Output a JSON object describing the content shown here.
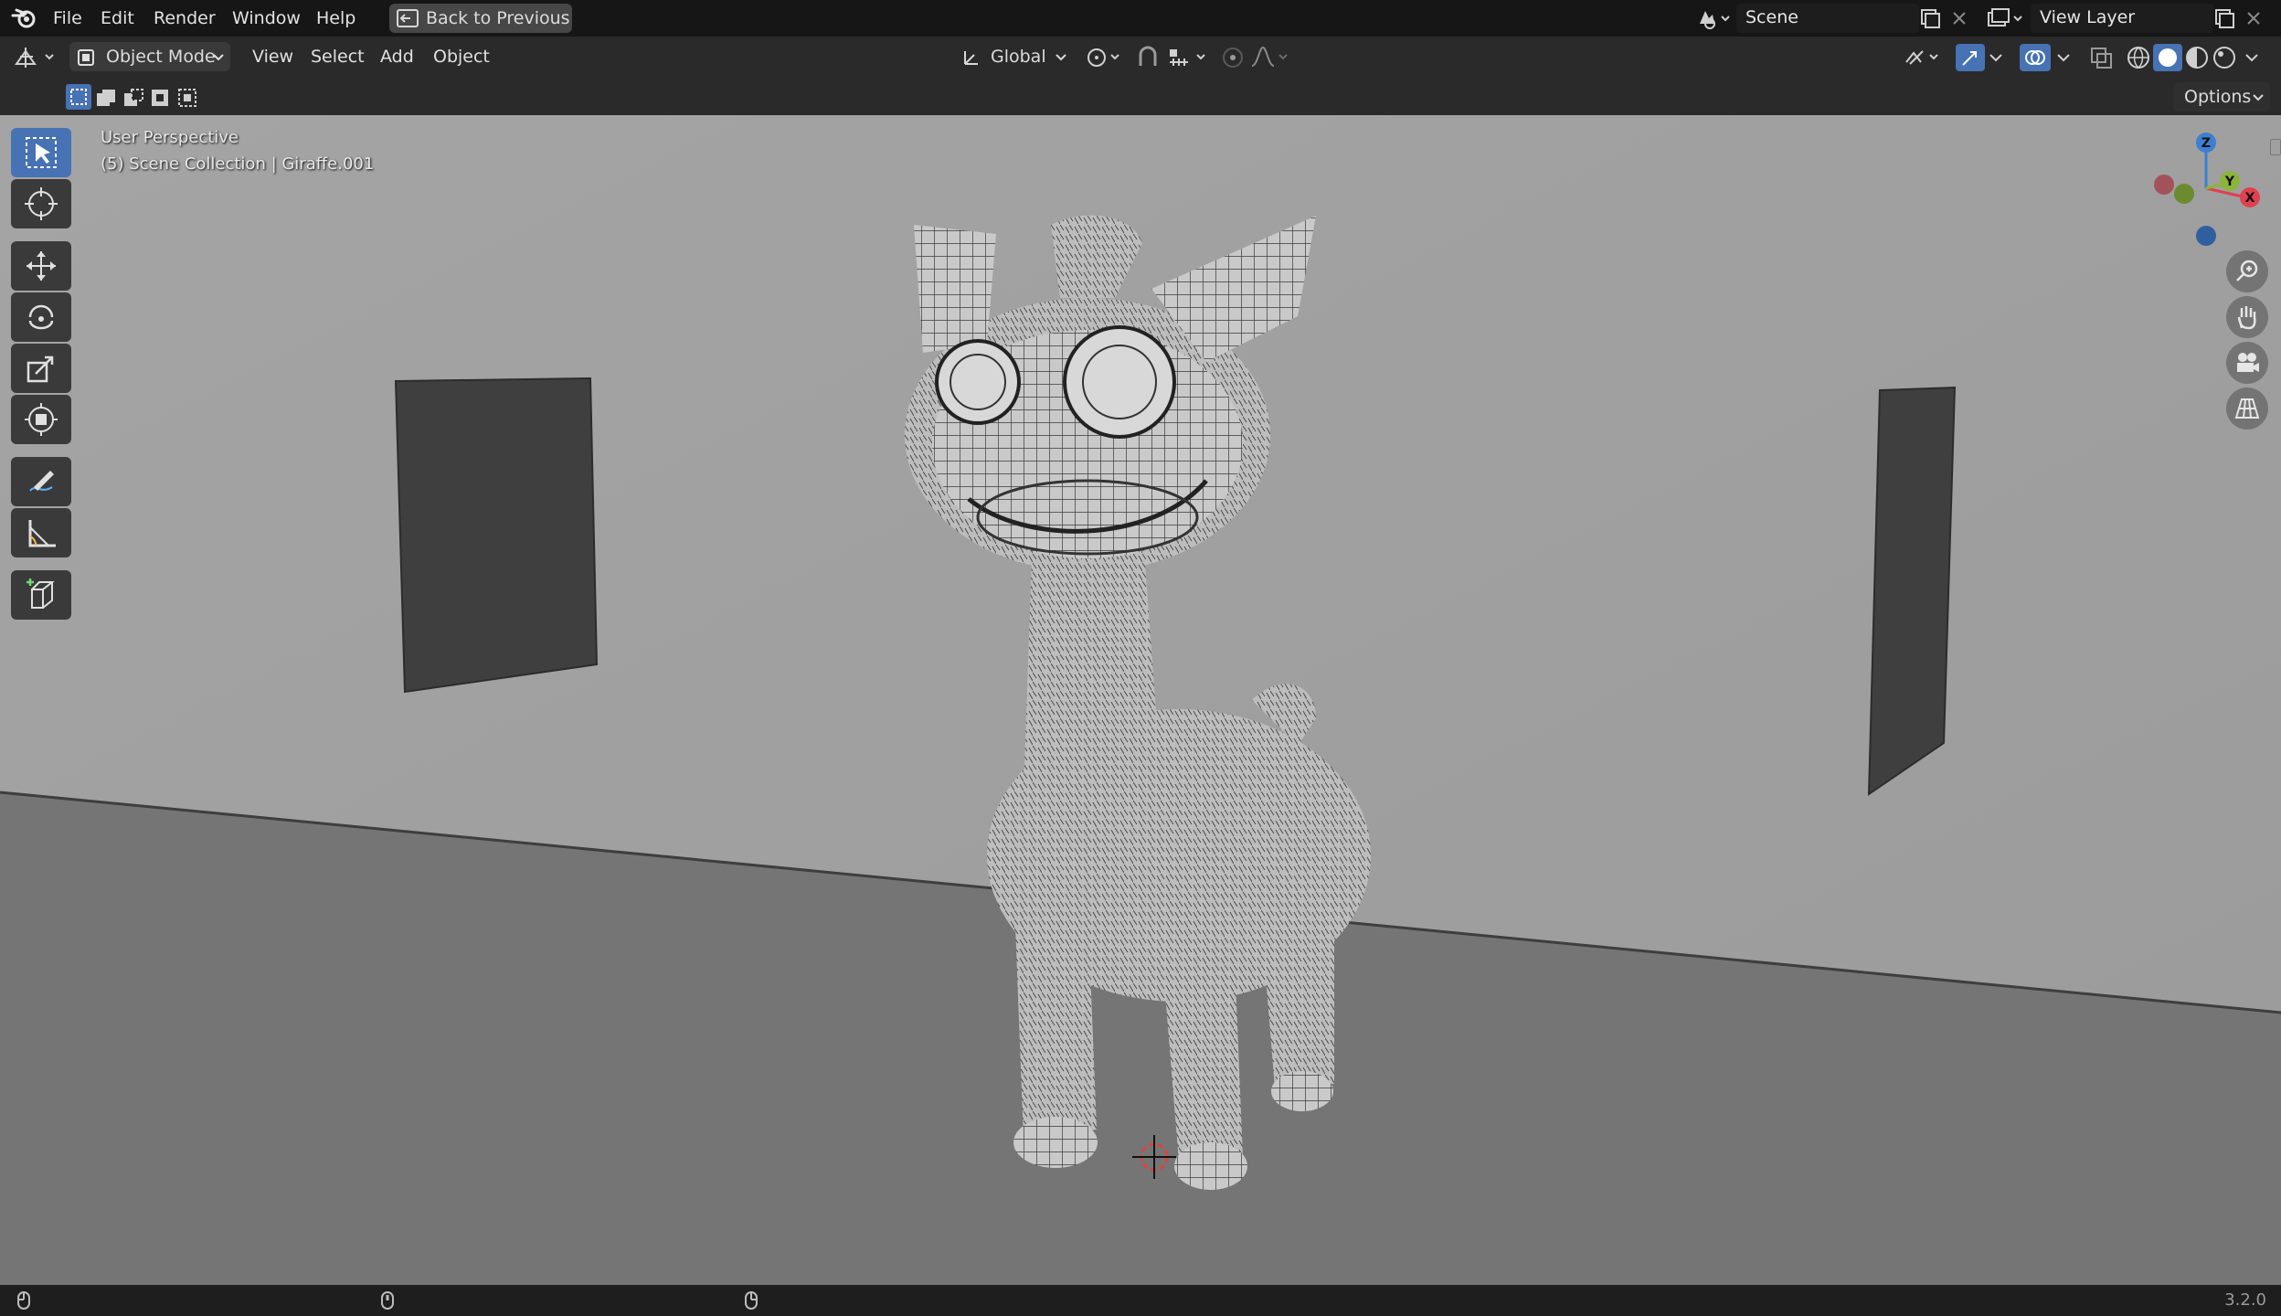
{
  "topbar": {
    "menus": [
      "File",
      "Edit",
      "Render",
      "Window",
      "Help"
    ],
    "back_button": "Back to Previous",
    "scene_field": "Scene",
    "view_layer_field": "View Layer"
  },
  "header": {
    "mode": "Object Mode",
    "menus": [
      "View",
      "Select",
      "Add",
      "Object"
    ],
    "transform_orientation": "Global"
  },
  "header3": {
    "options_label": "Options"
  },
  "viewport": {
    "perspective_label": "User Perspective",
    "collection_label": "(5) Scene Collection | Giraffe.001",
    "gizmo": {
      "x": "X",
      "y": "Y",
      "z": "Z"
    }
  },
  "colors": {
    "accent": "#4772b3",
    "axis_x": "#e0404f",
    "axis_y": "#8bb43c",
    "axis_z": "#3d7fd1",
    "wall": "#a1a1a1",
    "floor": "#757575"
  },
  "status": {
    "version": "3.2.0"
  }
}
